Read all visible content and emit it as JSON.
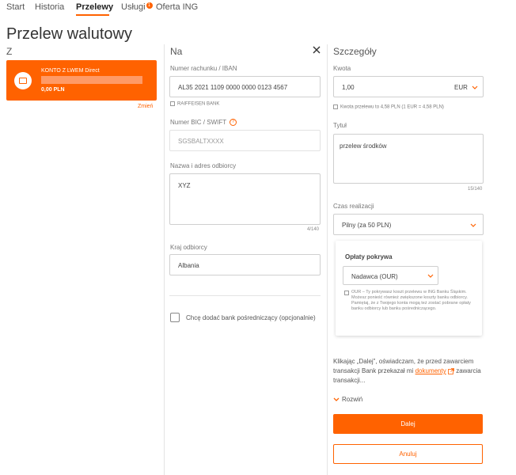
{
  "nav": {
    "items": [
      {
        "label": "Start"
      },
      {
        "label": "Historia"
      },
      {
        "label": "Przelewy"
      },
      {
        "label": "Usługi",
        "badge": "1"
      },
      {
        "label": "Oferta ING"
      }
    ],
    "active": "Przelewy"
  },
  "page": {
    "title": "Przelew walutowy"
  },
  "from": {
    "heading": "Z",
    "account_name": "KONTO Z LWEM Direct",
    "balance": "0,00 PLN",
    "change_link": "Zmień"
  },
  "to": {
    "heading": "Na",
    "iban_label": "Numer rachunku / IBAN",
    "iban_value": "AL35 2021 1109 0000 0000 0123 4567",
    "bank_name": "RAIFFEISEN BANK",
    "bic_label": "Numer BIC / SWIFT",
    "bic_value": "SGSBALTXXXX",
    "recipient_label": "Nazwa i adres odbiorcy",
    "recipient_value": "XYZ",
    "recipient_counter": "4/140",
    "country_label": "Kraj odbiorcy",
    "country_value": "Albania",
    "intermediary_label": "Chcę dodać bank pośredniczący (opcjonalnie)"
  },
  "details": {
    "heading": "Szczegóły",
    "amount_label": "Kwota",
    "amount_value": "1,00",
    "currency": "EUR",
    "conversion_note": "Kwota przelewu to 4,58 PLN (1 EUR = 4,58 PLN)",
    "title_label": "Tytuł",
    "title_value": "przelew środków",
    "title_counter": "15/140",
    "execution_label": "Czas realizacji",
    "execution_value": "Pilny (za 50 PLN)",
    "fees_title": "Opłaty pokrywa",
    "fees_value": "Nadawca (OUR)",
    "fees_desc": "OUR – Ty pokrywasz koszt przelewu w ING Banku Śląskim. Możesz ponieść również zwiększone koszty banku odbiorcy. Pamiętaj, że z Twojego konta mogą też zostać pobrane opłaty banku odbiorcy lub banku pośredniczącego.",
    "consent_before": "Klikając „Dalej”, oświadczam, że przed zawarciem transakcji Bank przekazał mi ",
    "consent_link": "dokumenty",
    "consent_after": " zawarcia transakcji...",
    "expand_label": "Rozwiń",
    "next_button": "Dalej",
    "cancel_button": "Anuluj"
  },
  "colors": {
    "accent": "#ff6200",
    "border": "#cfcfcf",
    "separator": "#e4e4e4"
  }
}
